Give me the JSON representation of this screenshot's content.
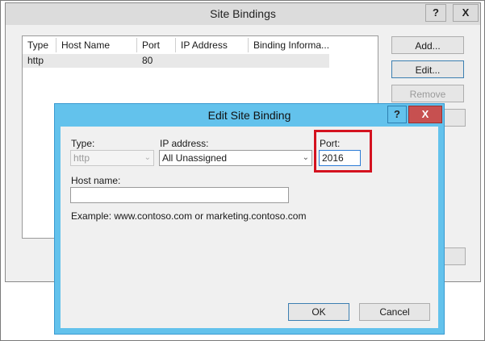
{
  "outer_dialog": {
    "title": "Site Bindings",
    "help_label": "?",
    "close_label": "X",
    "columns": [
      "Type",
      "Host Name",
      "Port",
      "IP Address",
      "Binding Informa..."
    ],
    "rows": [
      {
        "type": "http",
        "host_name": "",
        "port": "80",
        "ip_address": "",
        "binding_info": ""
      }
    ],
    "buttons": {
      "add": "Add...",
      "edit": "Edit...",
      "remove": "Remove"
    }
  },
  "inner_dialog": {
    "title": "Edit Site Binding",
    "help_label": "?",
    "close_label": "X",
    "type_label": "Type:",
    "type_value": "http",
    "ip_label": "IP address:",
    "ip_value": "All Unassigned",
    "port_label": "Port:",
    "port_value": "2016",
    "host_label": "Host name:",
    "host_value": "",
    "example_text": "Example: www.contoso.com or marketing.contoso.com",
    "ok_label": "OK",
    "cancel_label": "Cancel"
  },
  "colors": {
    "dialog_accent": "#63c2ec",
    "close_button": "#c75050",
    "highlight": "#d4121f"
  }
}
